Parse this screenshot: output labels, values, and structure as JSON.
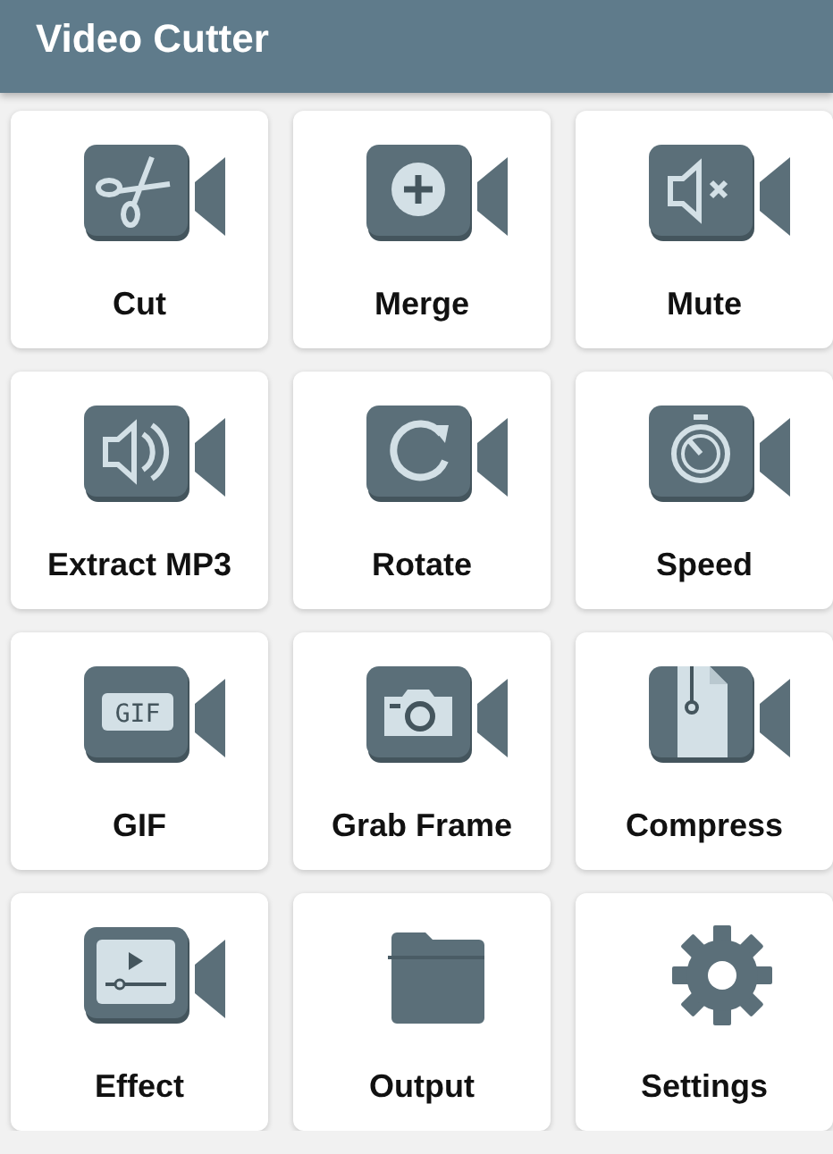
{
  "app_bar": {
    "title": "Video Cutter"
  },
  "tools": [
    {
      "label": "Cut"
    },
    {
      "label": "Merge"
    },
    {
      "label": "Mute"
    },
    {
      "label": "Extract MP3"
    },
    {
      "label": "Rotate"
    },
    {
      "label": "Speed"
    },
    {
      "label": "GIF",
      "icon_text": "GIF"
    },
    {
      "label": "Grab Frame"
    },
    {
      "label": "Compress"
    },
    {
      "label": "Effect"
    },
    {
      "label": "Output"
    },
    {
      "label": "Settings"
    }
  ]
}
